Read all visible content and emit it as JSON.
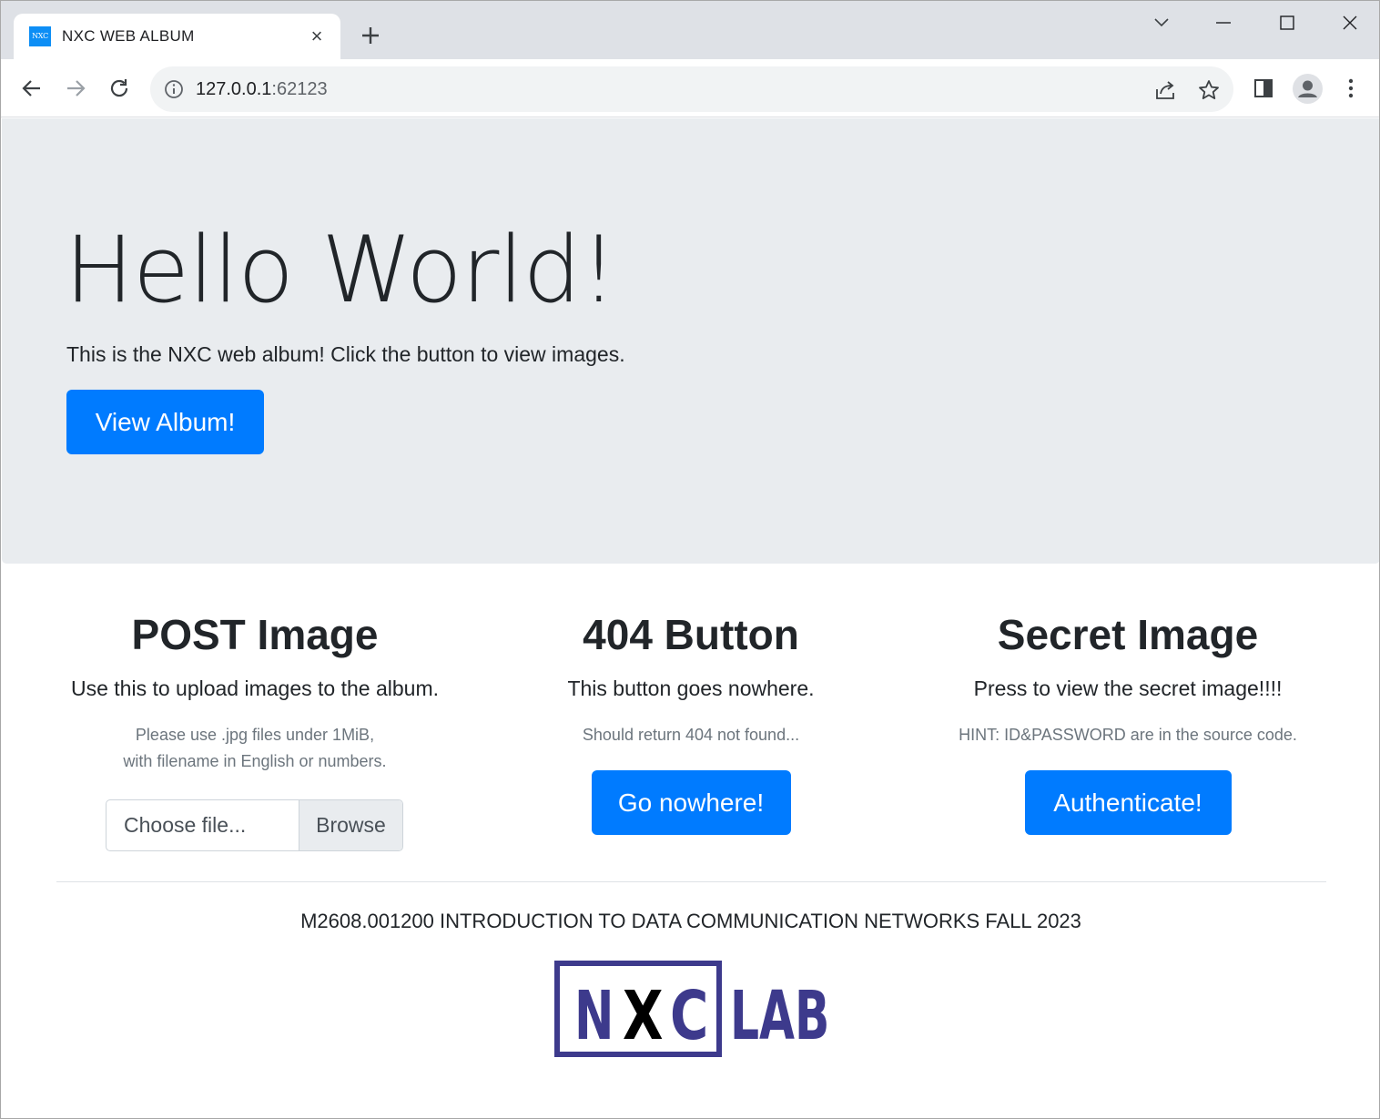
{
  "browser": {
    "tab": {
      "favicon_text": "NXC",
      "title": "NXC WEB ALBUM",
      "close_glyph": "×"
    },
    "address": {
      "host": "127.0.0.1",
      "port": ":62123"
    },
    "colors": {
      "tabstrip": "#dee1e6",
      "omnibox": "#f1f3f4",
      "icon": "#5f6368"
    }
  },
  "hero": {
    "title": "Hello World!",
    "lead": "This is the NXC web album! Click the button to view images.",
    "button": "View Album!"
  },
  "columns": [
    {
      "heading": "POST Image",
      "description": "Use this to upload images to the album.",
      "note_line1": "Please use .jpg files under 1MiB,",
      "note_line2": "with filename in English or numbers.",
      "file_placeholder": "Choose file...",
      "file_browse": "Browse"
    },
    {
      "heading": "404 Button",
      "description": "This button goes nowhere.",
      "note": "Should return 404 not found...",
      "button": "Go nowhere!"
    },
    {
      "heading": "Secret Image",
      "description": "Press to view the secret image!!!!",
      "note": "HINT: ID&PASSWORD are in the source code.",
      "button": "Authenticate!"
    }
  ],
  "footer": {
    "course": "M2608.001200 INTRODUCTION TO DATA COMMUNICATION NETWORKS FALL 2023",
    "logo": {
      "n": "N",
      "x": "X",
      "c": "C",
      "lab": "LAB",
      "color": "#3d3a8c"
    }
  },
  "theme": {
    "primary": "#007bff",
    "jumbotron": "#e9ecef",
    "muted": "#6c757d"
  }
}
